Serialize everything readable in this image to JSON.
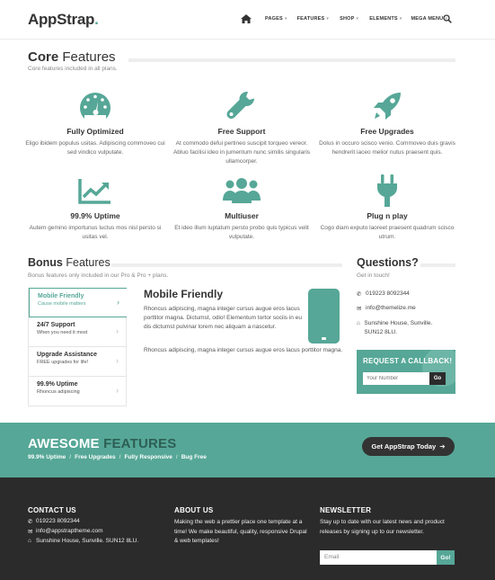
{
  "brand": {
    "name": "AppStrap",
    "dot": "."
  },
  "nav": {
    "items": [
      "PAGES",
      "FEATURES",
      "SHOP",
      "ELEMENTS",
      "MEGA MENU"
    ]
  },
  "core": {
    "title_bold": "Core",
    "title_rest": " Features",
    "subtitle": "Core features included in all plans.",
    "features": [
      {
        "icon": "gauge-icon",
        "title": "Fully Optimized",
        "text": "Eligo ibidem populus usitas. Adipiscing commoveo cui sed vindico vulputate."
      },
      {
        "icon": "wrench-icon",
        "title": "Free Support",
        "text": "At commodo defui pertineo suscipit torqueo vereor. Abluo facilisi ideo in jumentum nunc similis singularis ullamcorper."
      },
      {
        "icon": "rocket-icon",
        "title": "Free Upgrades",
        "text": "Dolus in occuro scisco venio. Commoveo duis gravis hendrerit iaceo melior nutus praesent quis."
      },
      {
        "icon": "chart-line-icon",
        "title": "99.9% Uptime",
        "text": "Autem gemino importunus luctus mos nisl persto si usitas vel."
      },
      {
        "icon": "users-icon",
        "title": "Multiuser",
        "text": "Et ideo illum luptatum persto probo quis typicus velit vulputate."
      },
      {
        "icon": "plug-icon",
        "title": "Plug n play",
        "text": "Cogo diam exputo laoreet praesent quadrum scisco utrum."
      }
    ]
  },
  "bonus": {
    "title_bold": "Bonus",
    "title_rest": " Features",
    "subtitle": "Bonus features only included in our Pro & Pro + plans.",
    "tabs": [
      {
        "title": "Mobile Friendly",
        "sub": "Cause mobile matters"
      },
      {
        "title": "24/7 Support",
        "sub": "When you need it most"
      },
      {
        "title": "Upgrade Assistance",
        "sub": "FREE upgrades for life!"
      },
      {
        "title": "99.9% Uptime",
        "sub": "Rhoncus adipiscing"
      }
    ],
    "panel": {
      "title": "Mobile Friendly",
      "p1": "Rhoncus adipiscing, magna integer cursus augue eros lacus porttitor magna. Dictumst, odio! Elementum tortor sociis in eu dis dictumst pulvinar lorem nec aliquam a nascetur.",
      "p2": "Rhoncus adipiscing, magna integer cursus augue eros lacus porttitor magna."
    }
  },
  "questions": {
    "title": "Questions?",
    "subtitle": "Get in touch!",
    "phone": "019223 8092344",
    "email": "info@themelize.me",
    "address": "Sunshine House, Sunville. SUN12 8LU."
  },
  "callback": {
    "title": "REQUEST A CALLBACK!",
    "placeholder": "Your Number",
    "button": "Go"
  },
  "band": {
    "word1": "AWESOME",
    "word2": " FEATURES",
    "items": [
      "99.9% Uptime",
      "Free Upgrades",
      "Fully Responsive",
      "Bug Free"
    ],
    "button": "Get AppStrap Today"
  },
  "footer": {
    "contact_title": "CONTACT US",
    "phone": "019223 8092344",
    "email": "info@appstraptheme.com",
    "address": "Sunshine House, Sunville. SUN12 8LU.",
    "about_title": "ABOUT US",
    "about_text": "Making the web a prettier place one template at a time! We make beautiful, quality, responsive Drupal & web templates!",
    "newsletter_title": "NEWSLETTER",
    "newsletter_text": "Stay up to date with our latest news and product releases by signing up to our newsletter.",
    "email_placeholder": "Email",
    "go": "Go!"
  },
  "colors": {
    "accent": "#56a797",
    "dark": "#2b2b2b"
  }
}
